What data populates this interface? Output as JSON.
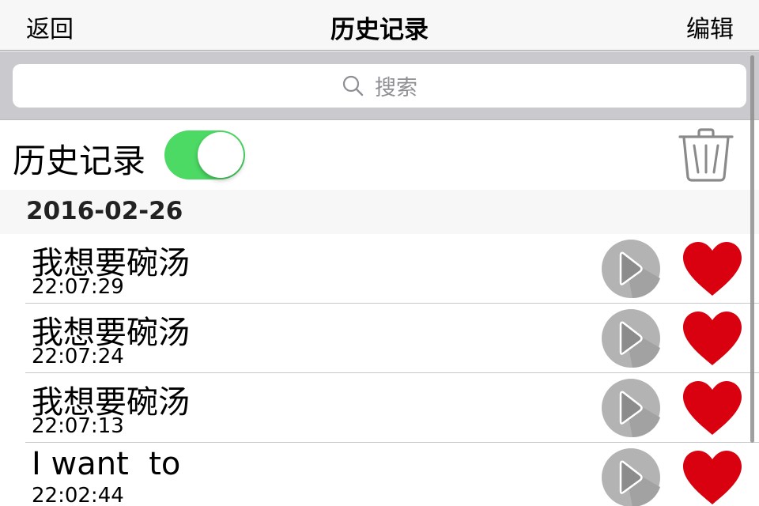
{
  "navbar": {
    "back_label": "返回",
    "title": "历史记录",
    "edit_label": "编辑"
  },
  "search": {
    "placeholder": "搜索",
    "icon": "search-icon"
  },
  "history_toggle": {
    "label": "历史记录",
    "enabled": true,
    "accent_color": "#4cd964"
  },
  "trash": {
    "icon": "trash-icon"
  },
  "section": {
    "date": "2016-02-26"
  },
  "items": [
    {
      "text": "我想要碗汤",
      "time": "22:07:29",
      "favorited": true
    },
    {
      "text": "我想要碗汤",
      "time": "22:07:24",
      "favorited": true
    },
    {
      "text": "我想要碗汤",
      "time": "22:07:13",
      "favorited": true
    },
    {
      "text": "I want  to",
      "time": "22:02:44",
      "favorited": true
    }
  ],
  "colors": {
    "heart": "#d9000f",
    "play_circle": "#b3b3b3",
    "play_triangle": "#8c8c8c"
  }
}
